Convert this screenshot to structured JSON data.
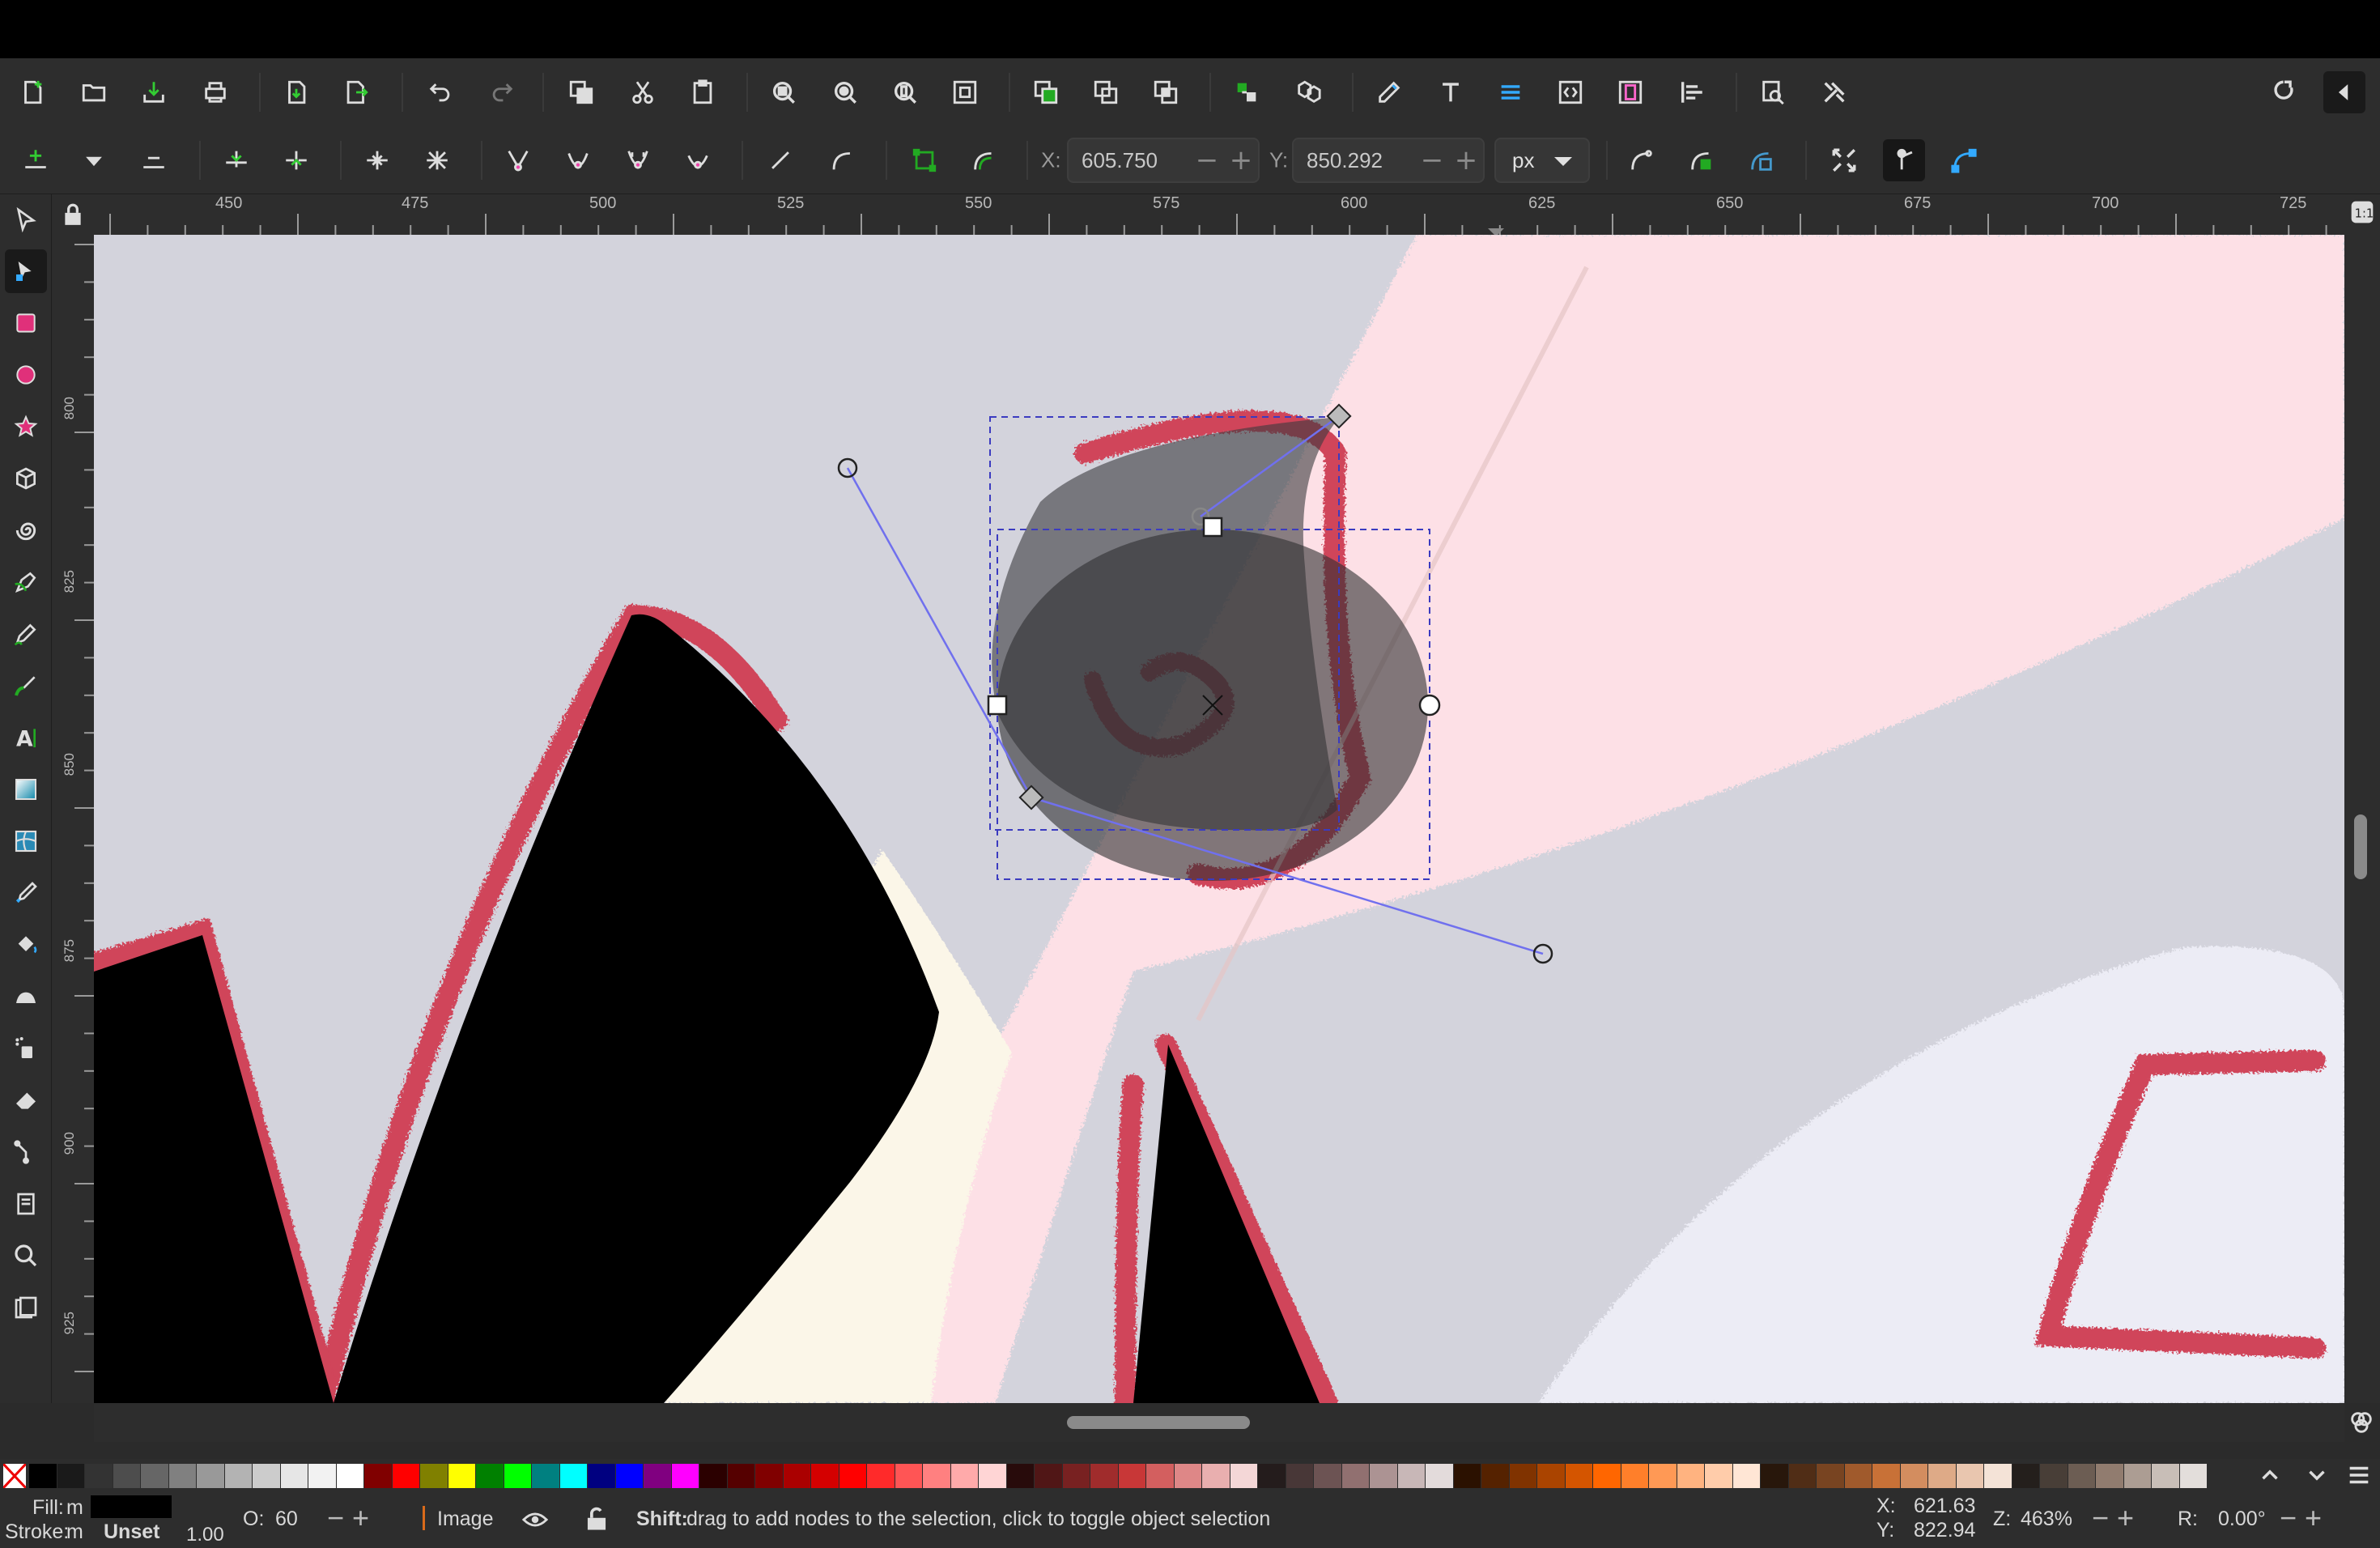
{
  "controls": {
    "x_label": "X:",
    "x_value": "605.750",
    "y_label": "Y:",
    "y_value": "850.292",
    "unit": "px"
  },
  "icons": {
    "commands": [
      "new-document-icon",
      "open-icon",
      "save-icon",
      "print-icon",
      "import-icon",
      "export-icon",
      "undo-icon",
      "redo-icon",
      "duplicate-icon",
      "cut-icon",
      "paste-icon",
      "zoom-selection-icon",
      "zoom-drawing-icon",
      "zoom-page-icon",
      "zoom-page-width-icon",
      "group-icon",
      "ungroup-icon",
      "clone-icon",
      "raise-icon",
      "lower-icon",
      "xml-editor-icon",
      "text-font-icon",
      "layers-icon",
      "fill-stroke-icon",
      "document-properties-icon",
      "align-distribute-icon",
      "find-icon",
      "preferences-icon"
    ],
    "node_controls": [
      "insert-node-icon",
      "insert-node-dropdown-icon",
      "delete-node-icon",
      "join-nodes-icon",
      "break-path-icon",
      "join-segment-icon",
      "delete-segment-icon",
      "cusp-node-icon",
      "smooth-node-icon",
      "symmetric-node-icon",
      "auto-smooth-node-icon",
      "line-segment-icon",
      "curve-segment-icon",
      "object-to-path-icon",
      "stroke-to-path-icon",
      "path-effects-icon",
      "clip-path-icon",
      "mask-icon",
      "show-transform-handles-icon",
      "show-handles-icon",
      "show-outline-icon"
    ],
    "tools": [
      "selector-tool-icon",
      "node-tool-icon",
      "rectangle-tool-icon",
      "ellipse-tool-icon",
      "star-tool-icon",
      "3d-box-tool-icon",
      "spiral-tool-icon",
      "pen-tool-icon",
      "pencil-tool-icon",
      "calligraphy-tool-icon",
      "text-tool-icon",
      "gradient-tool-icon",
      "mesh-tool-icon",
      "dropper-tool-icon",
      "paint-bucket-tool-icon",
      "tweak-tool-icon",
      "spray-tool-icon",
      "eraser-tool-icon",
      "connector-tool-icon",
      "pages-tool-icon",
      "zoom-tool-icon",
      "measure-tool-icon"
    ]
  },
  "rulers": {
    "h_labels": [
      "450",
      "475",
      "500",
      "525",
      "550",
      "575",
      "600",
      "625",
      "650",
      "675",
      "700",
      "725"
    ],
    "v_labels": [
      "800",
      "825",
      "850",
      "875",
      "900",
      "925"
    ]
  },
  "palette": {
    "colors": [
      "#000000",
      "#1a1a1a",
      "#333333",
      "#4d4d4d",
      "#666666",
      "#808080",
      "#999999",
      "#b3b3b3",
      "#cccccc",
      "#e6e6e6",
      "#f2f2f2",
      "#ffffff",
      "#800000",
      "#ff0000",
      "#808000",
      "#ffff00",
      "#008000",
      "#00ff00",
      "#008080",
      "#00ffff",
      "#000080",
      "#0000ff",
      "#800080",
      "#ff00ff",
      "#2b0000",
      "#550000",
      "#800000",
      "#aa0000",
      "#d40000",
      "#ff0000",
      "#ff2a2a",
      "#ff5555",
      "#ff8080",
      "#ffaaaa",
      "#ffd5d5",
      "#280b0b",
      "#501616",
      "#782121",
      "#a02c2c",
      "#c83737",
      "#d35f5f",
      "#de8787",
      "#e9afaf",
      "#f4d7d7",
      "#241c1c",
      "#483737",
      "#6c5353",
      "#917070",
      "#ac9393",
      "#c8b7b7",
      "#e3dbdb",
      "#2b1100",
      "#552200",
      "#803300",
      "#aa4400",
      "#d45500",
      "#ff6600",
      "#ff7f2a",
      "#ff9955",
      "#ffb380",
      "#ffccaa",
      "#ffe6d5",
      "#28170b",
      "#502d16",
      "#784421",
      "#a05a2c",
      "#c87137",
      "#d38d5f",
      "#deaa87",
      "#e9c6af",
      "#f4e3d7",
      "#241f1c",
      "#483e37",
      "#6c5d53",
      "#917c6f",
      "#ac9d93",
      "#c8beb7",
      "#e3dedb"
    ]
  },
  "status": {
    "fill_label": "Fill:",
    "fill_value": "m",
    "stroke_label": "Stroke:",
    "stroke_value": "m",
    "stroke_state": "Unset",
    "stroke_width": "1.00",
    "opacity_label": "O:",
    "opacity_value": "60",
    "layer_name": "Image",
    "message_bold": "Shift:",
    "message": "drag to add nodes to the selection, click to toggle object selection",
    "cursor_x_label": "X:",
    "cursor_x": "621.63",
    "cursor_y_label": "Y:",
    "cursor_y": "822.94",
    "zoom_label": "Z:",
    "zoom_value": "463%",
    "rotation_label": "R:",
    "rotation_value": "0.00°"
  },
  "colors": {
    "background": "#2b2b2b",
    "selection": "#4d4dcc",
    "canvas": "#d3d3dc"
  }
}
